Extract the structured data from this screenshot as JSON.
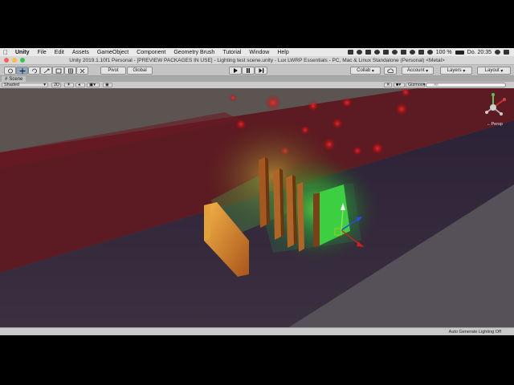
{
  "menubar": {
    "items": [
      "Unity",
      "File",
      "Edit",
      "Assets",
      "GameObject",
      "Component",
      "Geometry Brush",
      "Tutorial",
      "Window",
      "Help"
    ],
    "battery": "100 %",
    "clock": "Do. 20:35"
  },
  "window": {
    "title": "Unity 2019.1.10f1 Personal - [PREVIEW PACKAGES IN USE] - Lighting test scene.unity - Lux LWRP Essentials - PC, Mac & Linux Standalone (Personal) <Metal>"
  },
  "toolbar": {
    "pivot": "Pivot",
    "global": "Global",
    "collab": "Collab",
    "account": "Account",
    "layers": "Layers",
    "layout": "Layout"
  },
  "scene": {
    "tab_label": "Scene",
    "shading_mode": "Shaded",
    "mode_2d": "2D",
    "gizmos": "Gizmos",
    "search_placeholder": "All",
    "persp_label": "←Persp"
  },
  "status": {
    "text": "Auto Generate Lighting Off"
  },
  "colors": {
    "menubar_bg": "#e9e9e9",
    "toolbar_bg": "#c4c4c4",
    "viewport_floor": "#3e2f3a",
    "red_wall": "#5a1620",
    "glow_green": "#39d23a",
    "orange_panel": "#d9962f"
  },
  "icons": [
    "apple-icon",
    "hand-tool-icon",
    "move-tool-icon",
    "rotate-tool-icon",
    "scale-tool-icon",
    "rect-tool-icon",
    "transform-tool-icon",
    "custom-tool-icon",
    "play-icon",
    "pause-icon",
    "step-icon",
    "cloud-icon",
    "scene-gizmo-icon"
  ]
}
